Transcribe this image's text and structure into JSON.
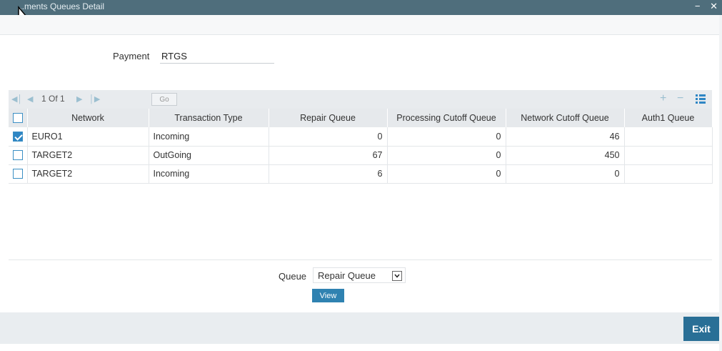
{
  "window": {
    "title": "...ments Queues Detail",
    "minimize": "−",
    "close": "✕"
  },
  "payment": {
    "label": "Payment",
    "value": "RTGS"
  },
  "pager": {
    "text": "1 Of 1",
    "go_label": "Go",
    "add": "+",
    "remove": "−"
  },
  "table": {
    "headers": [
      "Network",
      "Transaction Type",
      "Repair Queue",
      "Processing Cutoff Queue",
      "Network Cutoff Queue",
      "Auth1 Queue"
    ],
    "rows": [
      {
        "checked": true,
        "network": "EURO1",
        "txn_type": "Incoming",
        "repair": "0",
        "processing": "0",
        "network_cutoff": "46",
        "auth1": ""
      },
      {
        "checked": false,
        "network": "TARGET2",
        "txn_type": "OutGoing",
        "repair": "67",
        "processing": "0",
        "network_cutoff": "450",
        "auth1": ""
      },
      {
        "checked": false,
        "network": "TARGET2",
        "txn_type": "Incoming",
        "repair": "6",
        "processing": "0",
        "network_cutoff": "0",
        "auth1": ""
      }
    ]
  },
  "queue": {
    "label": "Queue",
    "selected": "Repair Queue",
    "view_label": "View"
  },
  "footer": {
    "exit_label": "Exit"
  },
  "colors": {
    "titlebar": "#4f6e7c",
    "accent": "#2f82b1",
    "exit": "#296f96"
  }
}
